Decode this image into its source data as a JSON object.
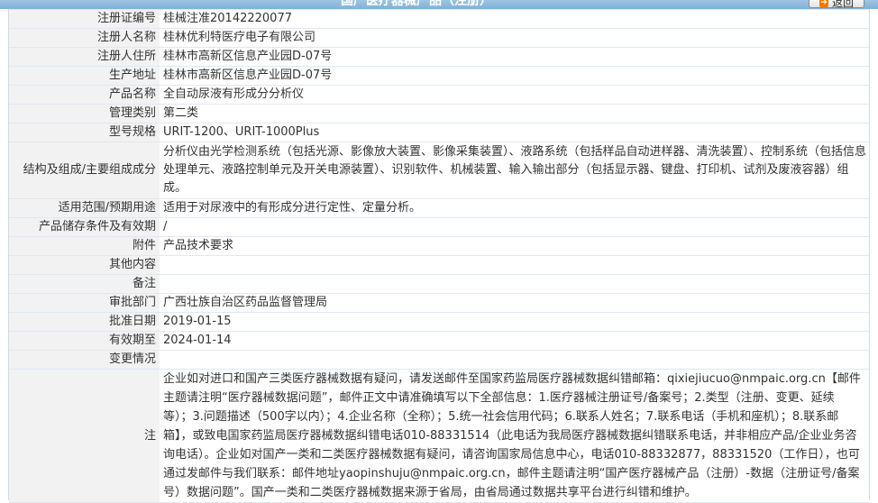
{
  "header": {
    "title": "国产医疗器械产品（注册）",
    "back_label": "返回"
  },
  "rows": [
    {
      "label": "注册证编号",
      "value": "桂械注准20142220077"
    },
    {
      "label": "注册人名称",
      "value": "桂林优利特医疗电子有限公司"
    },
    {
      "label": "注册人住所",
      "value": "桂林市高新区信息产业园D-07号"
    },
    {
      "label": "生产地址",
      "value": "桂林市高新区信息产业园D-07号"
    },
    {
      "label": "产品名称",
      "value": "全自动尿液有形成分分析仪"
    },
    {
      "label": "管理类别",
      "value": "第二类"
    },
    {
      "label": "型号规格",
      "value": "URIT-1200、URIT-1000Plus"
    },
    {
      "label": "结构及组成/主要组成成分",
      "value": "分析仪由光学检测系统（包括光源、影像放大装置、影像采集装置）、液路系统（包括样品自动进样器、清洗装置）、控制系统（包括信息处理单元、液路控制单元及开关电源装置）、识别软件、机械装置、输入输出部分（包括显示器、键盘、打印机、试剂及废液容器）组成。"
    },
    {
      "label": "适用范围/预期用途",
      "value": "适用于对尿液中的有形成分进行定性、定量分析。"
    },
    {
      "label": "产品储存条件及有效期",
      "value": "/"
    },
    {
      "label": "附件",
      "value": "产品技术要求"
    },
    {
      "label": "其他内容",
      "value": ""
    },
    {
      "label": "备注",
      "value": ""
    },
    {
      "label": "审批部门",
      "value": "广西壮族自治区药品监督管理局"
    },
    {
      "label": "批准日期",
      "value": "2019-01-15"
    },
    {
      "label": "有效期至",
      "value": "2024-01-14"
    },
    {
      "label": "变更情况",
      "value": ""
    }
  ],
  "note": {
    "label": "注",
    "text": "企业如对进口和国产三类医疗器械数据有疑问，请发送邮件至国家药监局医疗器械数据纠错邮箱：qixiejiucuo@nmpaic.org.cn【邮件主题请注明“医疗器械数据问题”，邮件正文中请准确填写以下全部信息：1.医疗器械注册证号/备案号；2.类型（注册、变更、延续等）；3.问题描述（500字以内）；4.企业名称（全称）；5.统一社会信用代码；6.联系人姓名；7.联系电话（手机和座机）；8.联系邮箱】，或致电国家药监局医疗器械数据纠错电话010-88331514（此电话为我局医疗器械数据纠错联系电话，并非相应产品/企业业务咨询电话）。企业如对国产一类和二类医疗器械数据有疑问，请咨询国家局信息中心，电话010-88332877，88331520（工作日），也可通过发邮件与我们联系：邮件地址yaopinshuju@nmpaic.org.cn，邮件主题请注明“国产医疗器械产品（注册）-数据（注册证号/备案号）数据问题”。国产一类和二类医疗器械数据来源于省局，由省局通过数据共享平台进行纠错和维护。"
  },
  "colors": {
    "header_bg": "#8fbbe0",
    "label_bg": "#f2f2f2",
    "border": "#dfe8f1",
    "back_icon": "#f07800"
  }
}
